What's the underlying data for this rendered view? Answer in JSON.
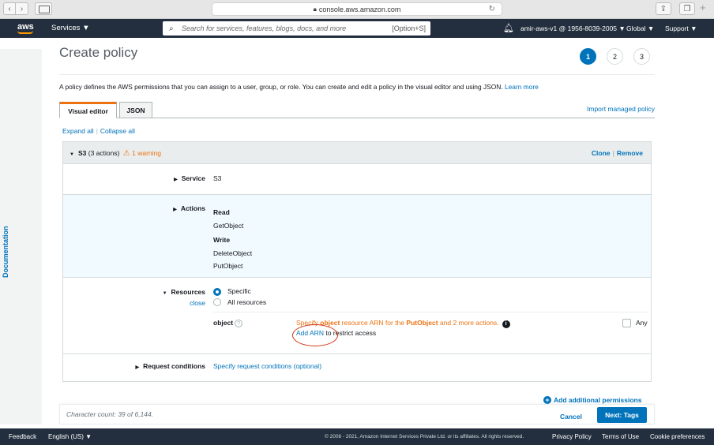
{
  "browser": {
    "back": "‹",
    "forward": "›",
    "url": "console.aws.amazon.com",
    "reload": "↻",
    "plus": "+"
  },
  "header": {
    "logo": "aws",
    "services": "Services ▼",
    "search_placeholder": "Search for services, features, blogs, docs, and more",
    "search_shortcut": "[Option+S]",
    "account": "amir-aws-v1 @ 1956-8039-2005 ▼",
    "region": "Global ▼",
    "support": "Support ▼"
  },
  "sidebar": {
    "documentation": "Documentation"
  },
  "page": {
    "title": "Create policy",
    "steps": [
      "1",
      "2",
      "3"
    ],
    "intro": "A policy defines the AWS permissions that you can assign to a user, group, or role. You can create and edit a policy in the visual editor and using JSON.",
    "learn_more": "Learn more"
  },
  "tabs": {
    "visual_editor": "Visual editor",
    "json": "JSON",
    "import": "Import managed policy"
  },
  "expand": {
    "expand_all": "Expand all",
    "collapse_all": "Collapse all"
  },
  "panel": {
    "service_name": "S3",
    "actions_count": "(3 actions)",
    "warning": "1 warning",
    "clone": "Clone",
    "remove": "Remove",
    "service_label": "Service",
    "service_value": "S3",
    "actions_label": "Actions",
    "read_label": "Read",
    "read_actions": [
      "GetObject"
    ],
    "write_label": "Write",
    "write_actions": [
      "DeleteObject",
      "PutObject"
    ],
    "resources_label": "Resources",
    "close": "close",
    "specific": "Specific",
    "all_resources": "All resources",
    "object_label": "object",
    "arn_warn_1": "Specify",
    "arn_warn_obj": "object",
    "arn_warn_2": "resource ARN for the",
    "arn_warn_put": "PutObject",
    "arn_warn_3": "and 2 more actions.",
    "add_arn": "Add ARN",
    "restrict": "to restrict access",
    "any": "Any",
    "request_conditions_label": "Request conditions",
    "request_conditions_link": "Specify request conditions (optional)"
  },
  "add_permissions": "Add additional permissions",
  "action_bar": {
    "char_count": "Character count: 39 of 6,144.",
    "cancel": "Cancel",
    "next": "Next: Tags"
  },
  "footer": {
    "feedback": "Feedback",
    "language": "English (US) ▼",
    "copyright": "© 2008 - 2021, Amazon Internet Services Private Ltd. or its affiliates. All rights reserved.",
    "privacy": "Privacy Policy",
    "terms": "Terms of Use",
    "cookies": "Cookie preferences"
  },
  "colors": {
    "primary": "#0073bb",
    "warning": "#ec7211",
    "header_bg": "#232f3e",
    "annotation": "#d13212"
  }
}
